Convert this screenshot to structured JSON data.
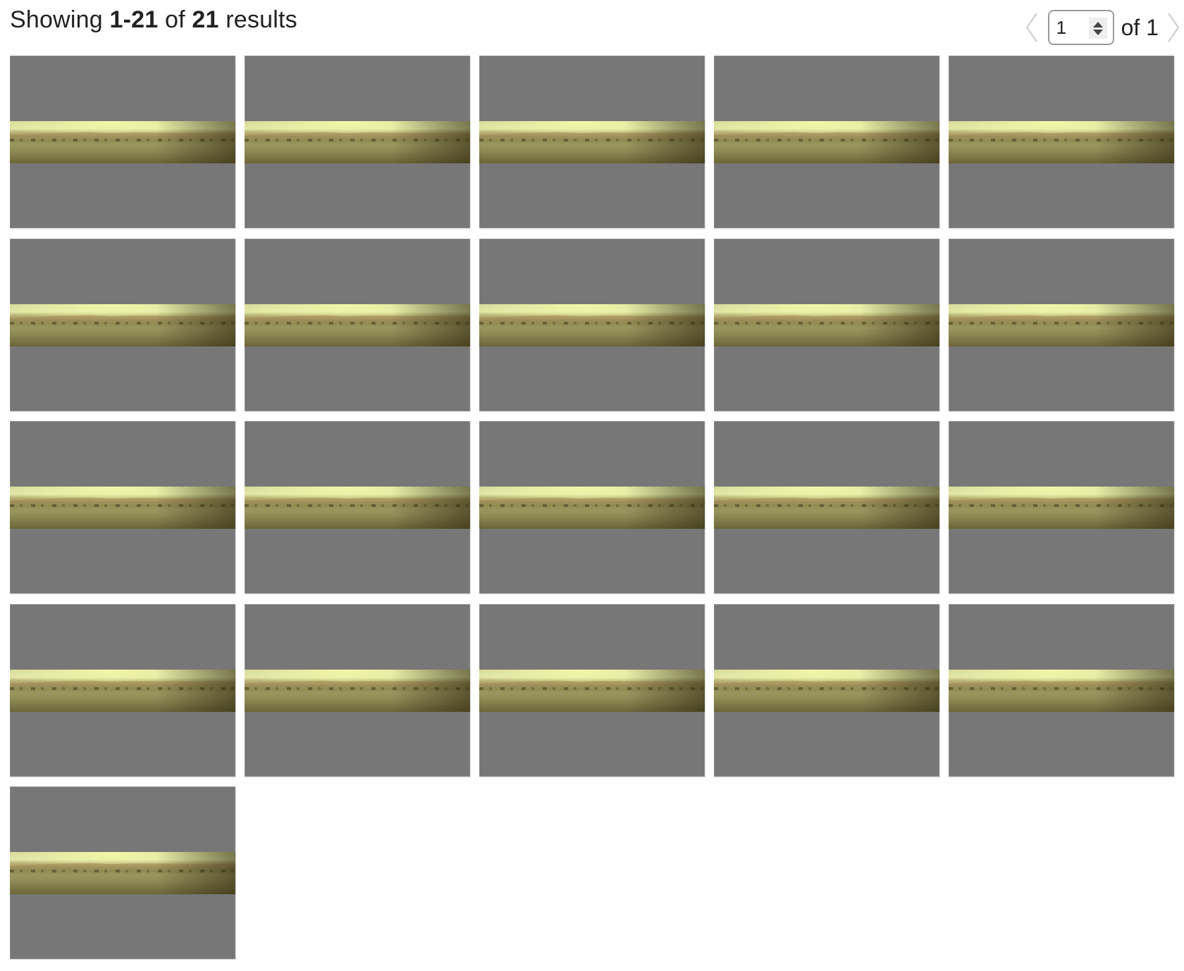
{
  "header": {
    "summary_prefix": "Showing ",
    "summary_range": "1-21",
    "summary_mid": " of ",
    "summary_total": "21",
    "summary_suffix": " results"
  },
  "pagination": {
    "current_page": "1",
    "of_label": "of 1",
    "prev_icon": "chevron-left-icon",
    "next_icon": "chevron-right-icon",
    "prev_enabled": false,
    "next_enabled": false
  },
  "gallery": {
    "columns": 5,
    "item_count": 21,
    "items": [
      {
        "index": 1,
        "alt": "Mars surface panorama"
      },
      {
        "index": 2,
        "alt": "Mars surface panorama"
      },
      {
        "index": 3,
        "alt": "Mars surface panorama"
      },
      {
        "index": 4,
        "alt": "Mars surface panorama"
      },
      {
        "index": 5,
        "alt": "Mars surface panorama"
      },
      {
        "index": 6,
        "alt": "Mars surface panorama"
      },
      {
        "index": 7,
        "alt": "Mars surface panorama"
      },
      {
        "index": 8,
        "alt": "Mars surface panorama"
      },
      {
        "index": 9,
        "alt": "Mars surface panorama"
      },
      {
        "index": 10,
        "alt": "Mars surface panorama"
      },
      {
        "index": 11,
        "alt": "Mars surface panorama"
      },
      {
        "index": 12,
        "alt": "Mars surface panorama"
      },
      {
        "index": 13,
        "alt": "Mars surface panorama"
      },
      {
        "index": 14,
        "alt": "Mars surface panorama"
      },
      {
        "index": 15,
        "alt": "Mars surface panorama"
      },
      {
        "index": 16,
        "alt": "Mars surface panorama"
      },
      {
        "index": 17,
        "alt": "Mars surface panorama"
      },
      {
        "index": 18,
        "alt": "Mars surface panorama"
      },
      {
        "index": 19,
        "alt": "Mars surface panorama"
      },
      {
        "index": 20,
        "alt": "Mars surface panorama"
      },
      {
        "index": 21,
        "alt": "Mars surface panorama"
      }
    ]
  },
  "colors": {
    "thumbnail_letterbox": "#777777",
    "text": "#222222",
    "disabled_arrow": "#cccccc",
    "input_border": "#9a9a9a"
  }
}
